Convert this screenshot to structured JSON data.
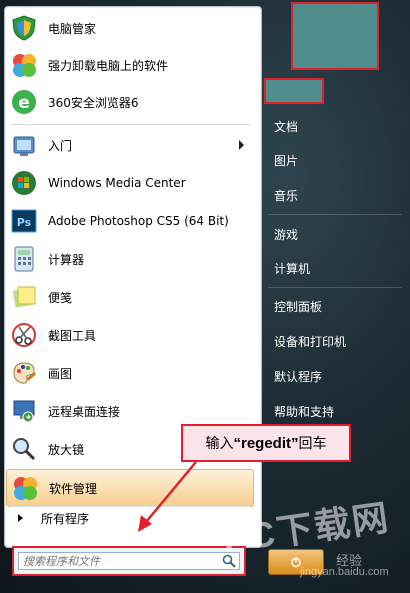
{
  "pinned": [
    {
      "label": "电脑管家",
      "icon": "shield-icon"
    },
    {
      "label": "强力卸载电脑上的软件",
      "icon": "clover-icon"
    },
    {
      "label": "360安全浏览器6",
      "icon": "browser-icon"
    }
  ],
  "recent": [
    {
      "label": "入门",
      "icon": "getting-started-icon",
      "has_submenu": true
    },
    {
      "label": "Windows Media Center",
      "icon": "windows-media-center-icon"
    },
    {
      "label": "Adobe Photoshop CS5 (64 Bit)",
      "icon": "photoshop-icon"
    },
    {
      "label": "计算器",
      "icon": "calculator-icon"
    },
    {
      "label": "便笺",
      "icon": "sticky-notes-icon"
    },
    {
      "label": "截图工具",
      "icon": "scissors-icon"
    },
    {
      "label": "画图",
      "icon": "paint-icon"
    },
    {
      "label": "远程桌面连接",
      "icon": "remote-desktop-icon"
    },
    {
      "label": "放大镜",
      "icon": "magnifier-icon"
    },
    {
      "label": "软件管理",
      "icon": "software-manager-icon",
      "highlighted": true
    }
  ],
  "all_programs": "所有程序",
  "search": {
    "placeholder": "搜索程序和文件"
  },
  "right_items": [
    "文档",
    "图片",
    "音乐",
    "游戏",
    "计算机",
    "控制面板",
    "设备和打印机",
    "默认程序",
    "帮助和支持"
  ],
  "callout": {
    "prefix": "输入",
    "keyword": "“regedit”",
    "suffix": "回车"
  },
  "watermark": {
    "big": "PC下载网",
    "site": "jingyan.baidu.com",
    "brand": "经验"
  },
  "colors": {
    "accent_red": "#e0202a",
    "user_tile": "#4f8e8c",
    "highlight": "#f8cf8e"
  }
}
